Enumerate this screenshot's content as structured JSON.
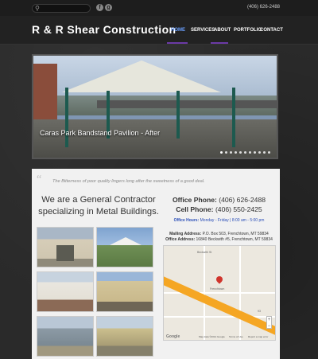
{
  "topbar": {
    "phone": "(406) 626-2488",
    "social": [
      {
        "icon": "facebook-icon",
        "glyph": "f"
      },
      {
        "icon": "google-plus-icon",
        "glyph": "g"
      }
    ]
  },
  "header": {
    "logo": "R & R Shear Construction",
    "nav": [
      {
        "label": "HOME",
        "active": true
      },
      {
        "label": "SERVICES",
        "active": false
      },
      {
        "label": "ABOUT",
        "active": false
      },
      {
        "label": "PORTFOLIO",
        "active": false
      },
      {
        "label": "CONTACT",
        "active": false
      }
    ],
    "active_color": "#6aa0ff",
    "underline_color": "#6b3aa6"
  },
  "slider": {
    "caption": "Caras Park Bandstand Pavilion - After",
    "slide_count": 11,
    "active_slide": 1
  },
  "content": {
    "quote": "The Bitterness of poor quality lingers long after the sweetness of a good deal.",
    "headline": "We are a General Contractor specializing in Metal Buildings.",
    "office_phone_label": "Office Phone:",
    "office_phone": "(406) 626-2488",
    "cell_phone_label": "Cell Phone:",
    "cell_phone": "(406) 550-2425",
    "hours_label": "Office Hours:",
    "hours": "Monday - Friday | 8:00 am - 5:00 pm",
    "mailing_label": "Mailing Address:",
    "mailing": "P.O. Box 503, Frenchtown, MT 59834",
    "office_addr_label": "Office Address:",
    "office_addr": "16840 Beckwith #5, Frenchtown, MT 59834",
    "map": {
      "google": "Google",
      "footer_data": "Map data ©2014 Google",
      "footer_terms": "Terms of Use",
      "footer_report": "Report a map error",
      "street_1": "Beckwith St",
      "street_2": "Frenchtown",
      "highway": "93"
    }
  }
}
